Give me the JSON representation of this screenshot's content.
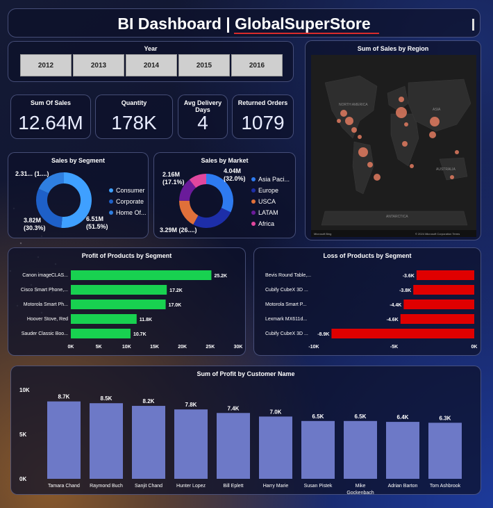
{
  "header": {
    "title": "BI Dashboard | GlobalSuperStore"
  },
  "year_slicer": {
    "title": "Year",
    "years": [
      "2012",
      "2013",
      "2014",
      "2015",
      "2016"
    ]
  },
  "kpis": [
    {
      "label": "Sum Of Sales",
      "value": "12.64M"
    },
    {
      "label": "Quantity",
      "value": "178K"
    },
    {
      "label": "Avg Delivery Days",
      "value": "4"
    },
    {
      "label": "Returned Orders",
      "value": "1079"
    }
  ],
  "map": {
    "title": "Sum of Sales by Region",
    "labels": [
      "NORTH AMERICA",
      "ASIA",
      "AUSTRALIA",
      "ANTARCTICA"
    ],
    "attribution_left": "Microsoft Bing",
    "attribution_right": "© 2024 Microsoft Corporation  Terms"
  },
  "colors": {
    "segment": [
      "#3fa0ff",
      "#1e60c8",
      "#2f7fe0"
    ],
    "market": [
      "#2e7bf0",
      "#1d2ea8",
      "#e0703a",
      "#6a1b9a",
      "#e0479e"
    ],
    "profit_bar": "#18d150",
    "loss_bar": "#e00000",
    "customer_bar": "#6d79c7"
  },
  "chart_data": [
    {
      "type": "donut",
      "title": "Sales by Segment",
      "categories": [
        "Consumer",
        "Corporate",
        "Home Of..."
      ],
      "values": [
        6.51,
        3.82,
        2.31
      ],
      "labels": [
        "6.51M\n(51.5%)",
        "3.82M\n(30.3%)",
        "2.31... (1....)"
      ],
      "legend": "right"
    },
    {
      "type": "donut",
      "title": "Sales by Market",
      "categories": [
        "Asia Paci...",
        "Europe",
        "USCA",
        "LATAM",
        "Africa"
      ],
      "values": [
        4.04,
        3.29,
        2.16,
        1.8,
        1.35
      ],
      "labels": [
        "4.04M\n(32.0%)",
        "3.29M (26....)",
        "2.16M\n(17.1%)"
      ],
      "legend": "right"
    },
    {
      "type": "bar",
      "orientation": "horizontal",
      "title": "Profit of Products by Segment",
      "categories": [
        "Canon imageCLAS...",
        "Cisco Smart Phone,...",
        "Motorola Smart Ph...",
        "Hoover Stove, Red",
        "Sauder Classic Boo..."
      ],
      "values": [
        25.2,
        17.2,
        17.0,
        11.8,
        10.7
      ],
      "value_labels": [
        "25.2K",
        "17.2K",
        "17.0K",
        "11.8K",
        "10.7K"
      ],
      "xlim": [
        0,
        30
      ],
      "xticks": [
        "0K",
        "5K",
        "10K",
        "15K",
        "20K",
        "25K",
        "30K"
      ]
    },
    {
      "type": "bar",
      "orientation": "horizontal",
      "title": "Loss of Products by Segment",
      "categories": [
        "Bevis Round Table,...",
        "Cubify CubeX 3D ...",
        "Motorola Smart P...",
        "Lexmark MX611d...",
        "Cubify CubeX 3D ..."
      ],
      "values": [
        -3.6,
        -3.8,
        -4.4,
        -4.6,
        -8.9
      ],
      "value_labels": [
        "-3.6K",
        "-3.8K",
        "-4.4K",
        "-4.6K",
        "-8.9K"
      ],
      "xlim": [
        -10,
        0
      ],
      "xticks": [
        "-10K",
        "-5K",
        "0K"
      ]
    },
    {
      "type": "bar",
      "title": "Sum of Profit by Customer Name",
      "categories": [
        "Tamara Chand",
        "Raymond Buch",
        "Sanjit Chand",
        "Hunter Lopez",
        "Bill Eplett",
        "Harry Marie",
        "Susan Pistek",
        "Mike Gockenbach",
        "Adrian Barton",
        "Tom Ashbrook"
      ],
      "values": [
        8.7,
        8.5,
        8.2,
        7.8,
        7.4,
        7.0,
        6.5,
        6.5,
        6.4,
        6.3
      ],
      "value_labels": [
        "8.7K",
        "8.5K",
        "8.2K",
        "7.8K",
        "7.4K",
        "7.0K",
        "6.5K",
        "6.5K",
        "6.4K",
        "6.3K"
      ],
      "ylim": [
        0,
        10
      ],
      "yticks": [
        "0K",
        "5K",
        "10K"
      ]
    }
  ]
}
